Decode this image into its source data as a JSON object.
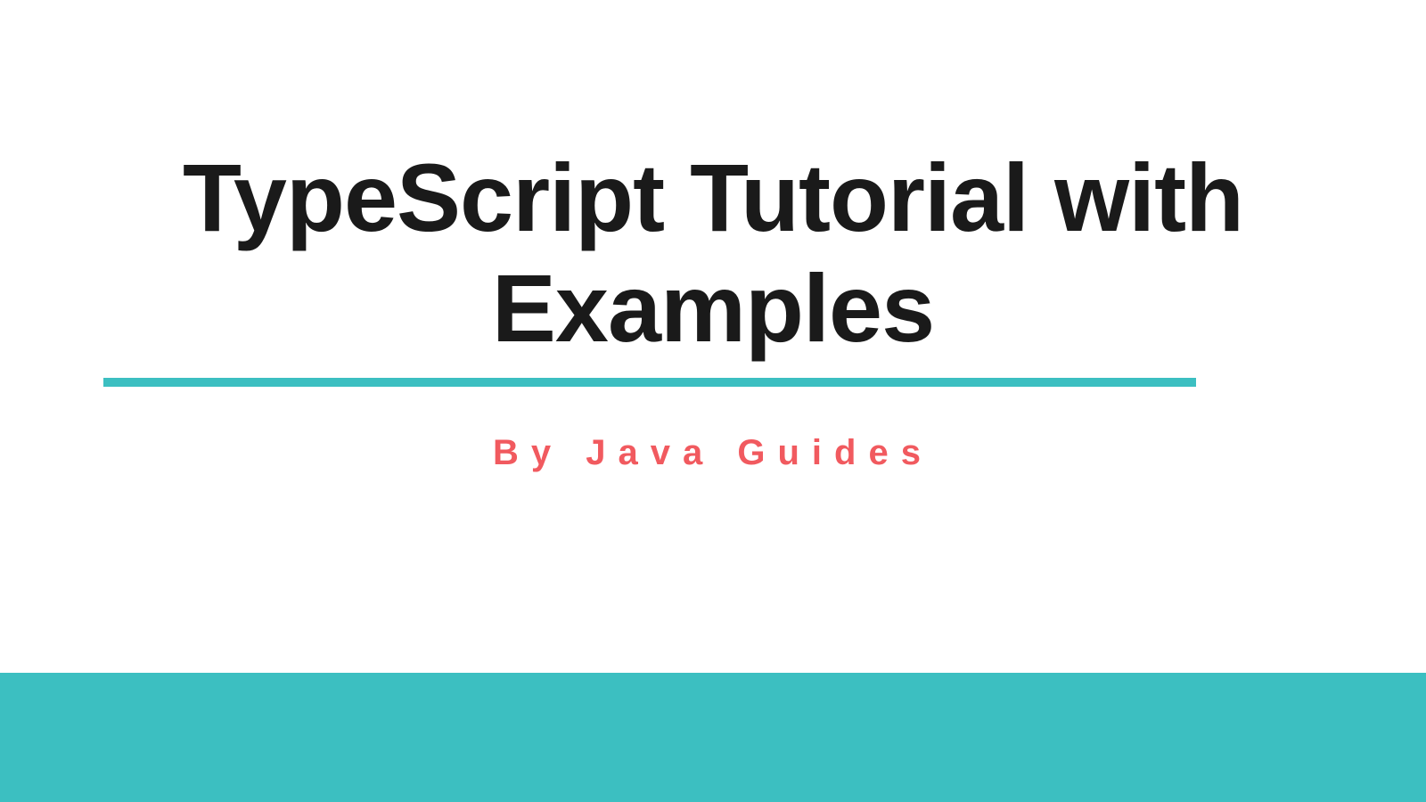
{
  "title": "TypeScript Tutorial with Examples",
  "subtitle": "By Java Guides",
  "colors": {
    "accent": "#3cbfc1",
    "subtitle": "#f15a5f",
    "title": "#1a1a1a"
  }
}
